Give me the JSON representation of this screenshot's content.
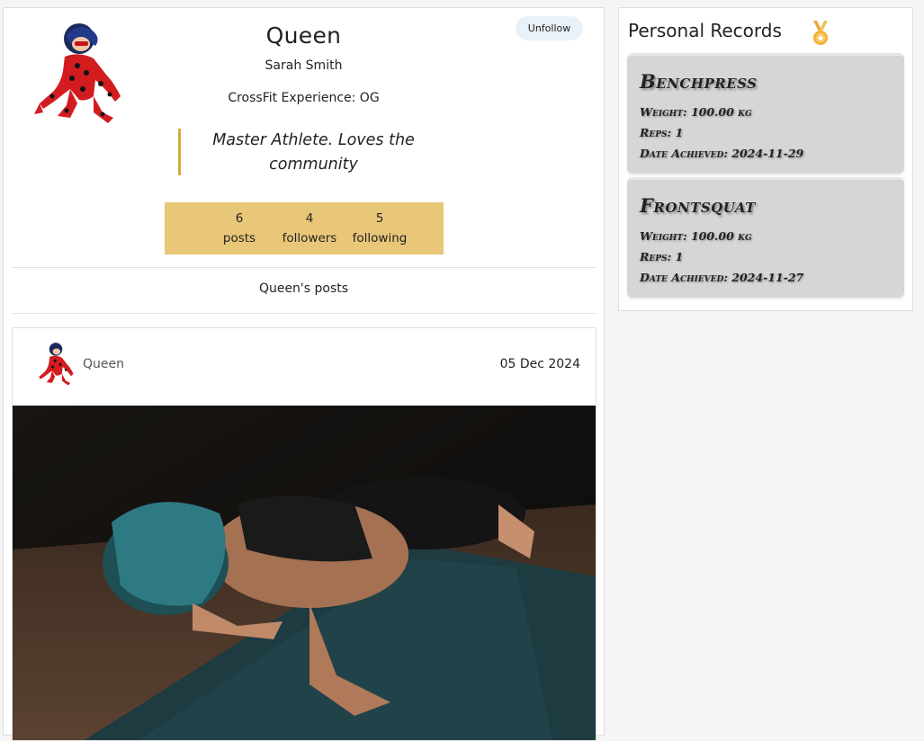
{
  "profile": {
    "username": "Queen",
    "full_name": "Sarah Smith",
    "experience": "CrossFit Experience: OG",
    "bio": "Master Athlete. Loves the community",
    "unfollow_label": "Unfollow",
    "avatar_icon": "ladybug-hero-avatar",
    "stats": [
      {
        "value": "6",
        "label": "posts"
      },
      {
        "value": "4",
        "label": "followers"
      },
      {
        "value": "5",
        "label": "following"
      }
    ],
    "posts_heading": "Queen's posts"
  },
  "post": {
    "username": "Queen",
    "date": "05 Dec 2024",
    "image_icon": "woman-pushup-photo"
  },
  "records": {
    "title": "Personal Records",
    "title_icon": "medal-icon",
    "items": [
      {
        "name": "Benchpress",
        "weight": "Weight: 100.00 kg",
        "reps": "Reps: 1",
        "date": "Date Achieved: 2024-11-29"
      },
      {
        "name": "Frontsquat",
        "weight": "Weight: 100.00 kg",
        "reps": "Reps: 1",
        "date": "Date Achieved: 2024-11-27"
      }
    ]
  },
  "colors": {
    "accent_gold": "#e9c778",
    "bio_border": "#d9a93a",
    "unfollow_bg": "#e9f1f8",
    "record_card_bg": "#d6d6d6"
  }
}
